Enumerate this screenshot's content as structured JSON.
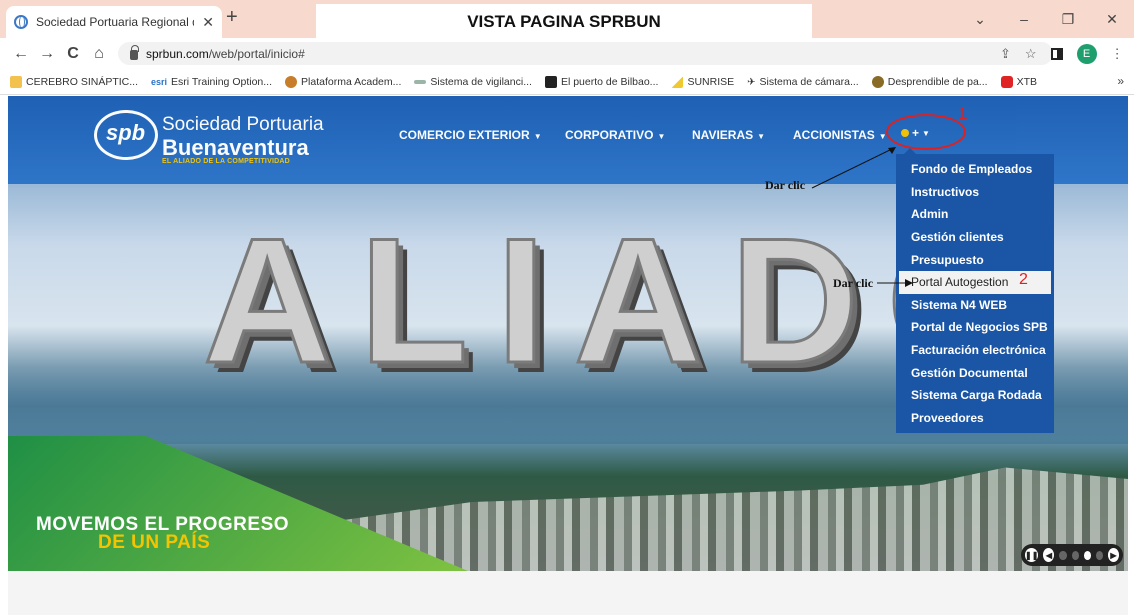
{
  "browser": {
    "tab_title": "Sociedad Portuaria Regional de B",
    "tab_close": "✕",
    "new_tab": "+",
    "window_controls": [
      "⌄",
      "–",
      "❐",
      "✕"
    ],
    "nav": {
      "back": "←",
      "forward": "→",
      "reload": "C",
      "home": "⌂"
    },
    "url_host": "sprbun.com",
    "url_path": "/web/portal/inicio#",
    "omni_icons": [
      "share-icon",
      "star-icon",
      "sidepanel-icon",
      "profile-avatar",
      "menu-icon"
    ],
    "profile_initial": "E",
    "bookmarks": [
      {
        "label": "CEREBRO SINÁPTIC...",
        "icon": "folder-icon",
        "color": "#f2c14e"
      },
      {
        "label": "Esri Training Option...",
        "icon": "esri-icon",
        "color": "#2a72c9",
        "prefix": "esri"
      },
      {
        "label": "Plataforma Academ...",
        "icon": "academ-icon",
        "color": "#c87d2a"
      },
      {
        "label": "Sistema de vigilanci...",
        "icon": "sistema-icon",
        "color": "#9bb6a8"
      },
      {
        "label": "El puerto de Bilbao...",
        "icon": "bilbao-icon",
        "color": "#222222"
      },
      {
        "label": "SUNRISE",
        "icon": "sunrise-icon",
        "color": "#f0c830"
      },
      {
        "label": "Sistema de cámara...",
        "icon": "camera-icon",
        "color": "#333333"
      },
      {
        "label": "Desprendible de pa...",
        "icon": "desprendible-icon",
        "color": "#8a6b25"
      },
      {
        "label": "XTB",
        "icon": "xtb-icon",
        "color": "#e02424"
      }
    ],
    "bookmarks_more": "»"
  },
  "banner_title": "VISTA PAGINA SPRBUN",
  "site": {
    "logo": {
      "mark": "spb",
      "line1": "Sociedad Portuaria",
      "line2": "Buenaventura",
      "tagline": "EL ALIADO DE LA COMPETITIVIDAD"
    },
    "nav": [
      {
        "label": "COMERCIO EXTERIOR"
      },
      {
        "label": "CORPORATIVO"
      },
      {
        "label": "NAVIERAS"
      },
      {
        "label": "ACCIONISTAS"
      }
    ],
    "more_label": "+",
    "dropdown_items": [
      "Fondo de Empleados",
      "Instructivos",
      "Admin",
      "Gestión clientes",
      "Presupuesto",
      "Portal Autogestion",
      "Sistema N4 WEB",
      "Portal de Negocios SPB",
      "Facturación electrónica",
      "Gestión Documental",
      "Sistema Carga Rodada",
      "Proveedores"
    ],
    "active_item_index": 5,
    "hero_word": "ALIADO",
    "slogan_line1": "MOVEMOS EL PROGRESO",
    "slogan_line2": "DE UN PAÍS",
    "slider_pages": 4,
    "slider_active": 3
  },
  "annotations": {
    "step1": "1",
    "step2": "2",
    "callout1": "Dar clic",
    "callout2": "Dar clic",
    "color": "#e02020"
  }
}
